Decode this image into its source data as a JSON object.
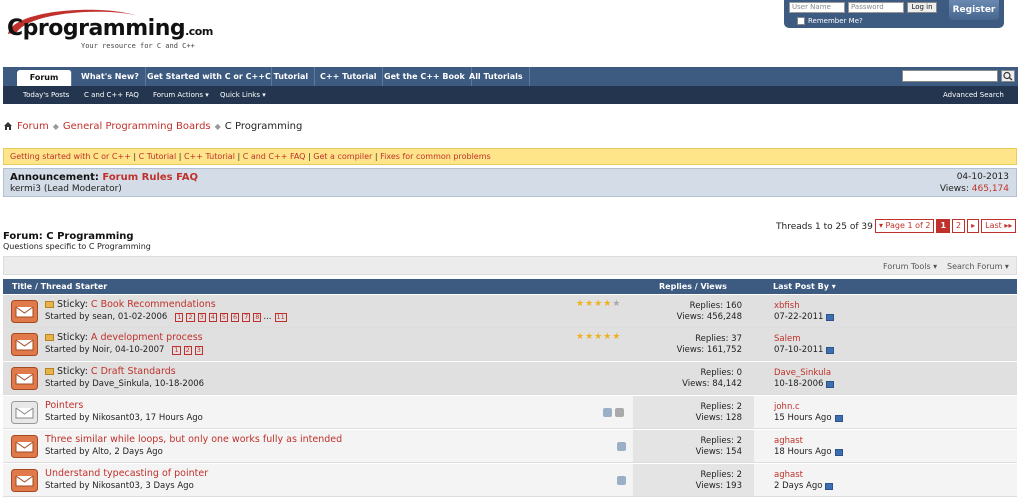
{
  "logo": {
    "name": "Cprogramming",
    "domain": ".com",
    "tagline": "Your resource for C and C++"
  },
  "login": {
    "username_placeholder": "User Name",
    "password_placeholder": "Password",
    "login_label": "Log in",
    "remember_label": "Remember Me?",
    "register_label": "Register"
  },
  "nav": {
    "tabs": [
      "Forum",
      "What's New?",
      "Get Started with C or C++",
      "C Tutorial",
      "C++ Tutorial",
      "Get the C++ Book",
      "All Tutorials"
    ],
    "sub": [
      "Today's Posts",
      "C and C++ FAQ",
      "Forum Actions ▾",
      "Quick Links ▾"
    ],
    "advanced_search": "Advanced Search"
  },
  "breadcrumb": {
    "home": "Forum",
    "parent": "General Programming Boards",
    "current": "C Programming"
  },
  "notice_links": [
    "Getting started with C or C++",
    "C Tutorial",
    "C++ Tutorial",
    "C and C++ FAQ",
    "Get a compiler",
    "Fixes for common problems"
  ],
  "announcement": {
    "label": "Announcement:",
    "title": "Forum Rules FAQ",
    "author": "kermi3 (Lead Moderator)",
    "date": "04-10-2013",
    "views_label": "Views:",
    "views": "465,174"
  },
  "forum": {
    "title": "Forum: C Programming",
    "desc": "Questions specific to C Programming",
    "threads_count": "Threads 1 to 25 of 39"
  },
  "pagination": {
    "page_of": "▾ Page 1 of 2",
    "p1": "1",
    "p2": "2",
    "next": "▸",
    "last": "Last ▸▸"
  },
  "tools": {
    "forum_tools": "Forum Tools ▾",
    "search_forum": "Search Forum ▾"
  },
  "columns": {
    "title": "Title / Thread Starter",
    "replies": "Replies / Views",
    "last_post": "Last Post By ▾"
  },
  "threads": [
    {
      "sticky": "Sticky:",
      "title": "C Book Recommendations",
      "starter": "Started by sean, 01-02-2006",
      "pages": [
        "1",
        "2",
        "3",
        "4",
        "5",
        "6",
        "7",
        "8",
        "...",
        "11"
      ],
      "replies": "Replies: 160",
      "views": "Views: 456,248",
      "last_by": "xbfish",
      "last_date": "07-22-2011"
    },
    {
      "sticky": "Sticky:",
      "title": "A development process",
      "starter": "Started by Noir, 04-10-2007",
      "pages": [
        "1",
        "2",
        "3"
      ],
      "replies": "Replies: 37",
      "views": "Views: 161,752",
      "last_by": "Salem",
      "last_date": "07-10-2011"
    },
    {
      "sticky": "Sticky:",
      "title": "C Draft Standards",
      "starter": "Started by Dave_Sinkula, 10-18-2006",
      "pages": [],
      "replies": "Replies: 0",
      "views": "Views: 84,142",
      "last_by": "Dave_Sinkula",
      "last_date": "10-18-2006"
    },
    {
      "sticky": "",
      "title": "Pointers",
      "starter": "Started by Nikosant03, 17 Hours Ago",
      "pages": [],
      "replies": "Replies: 2",
      "views": "Views: 128",
      "last_by": "john.c",
      "last_date": "15 Hours Ago"
    },
    {
      "sticky": "",
      "title": "Three similar while loops, but only one works fully as intended",
      "starter": "Started by Alto, 2 Days Ago",
      "pages": [],
      "replies": "Replies: 2",
      "views": "Views: 154",
      "last_by": "aghast",
      "last_date": "18 Hours Ago"
    },
    {
      "sticky": "",
      "title": "Understand typecasting of pointer",
      "starter": "Started by Nikosant03, 3 Days Ago",
      "pages": [],
      "replies": "Replies: 2",
      "views": "Views: 193",
      "last_by": "aghast",
      "last_date": "2 Days Ago"
    }
  ],
  "colors": {
    "accent": "#c0312b",
    "nav": "#3d5a80",
    "subnav": "#24364f",
    "notice": "#ffe58a"
  }
}
